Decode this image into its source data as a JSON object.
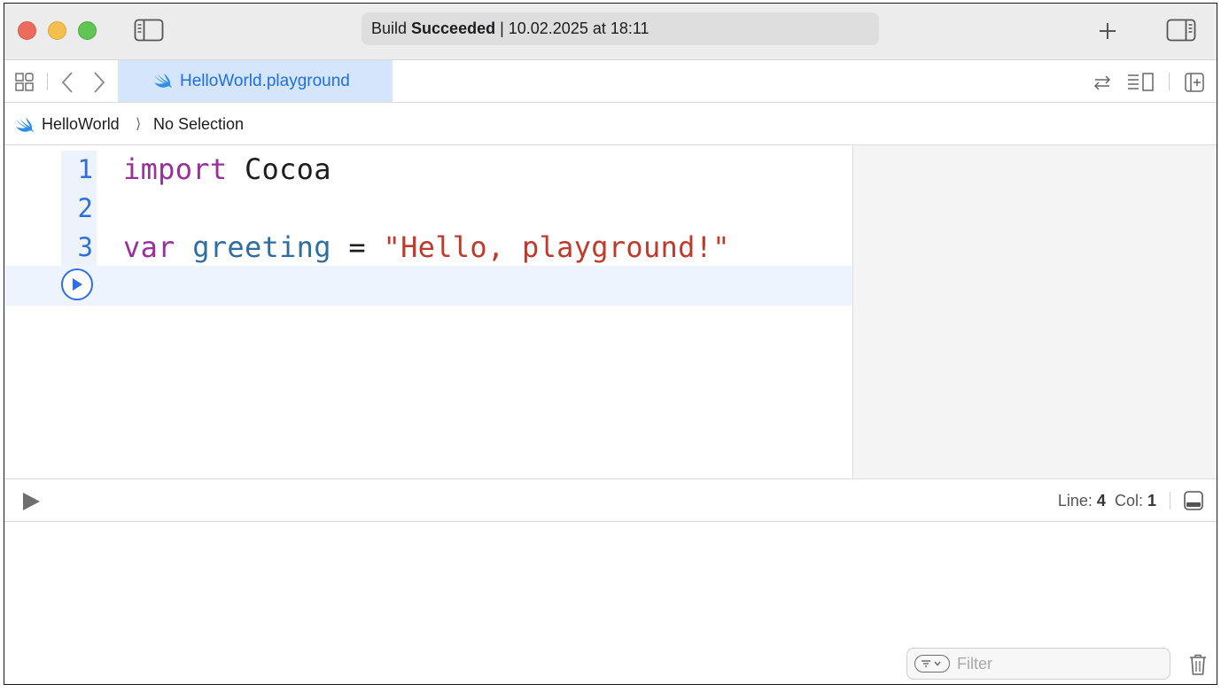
{
  "titlebar": {
    "status_prefix": "Build",
    "status_bold": "Succeeded",
    "status_suffix": "| 10.02.2025 at 18:11"
  },
  "tabbar": {
    "active_tab": "HelloWorld.playground"
  },
  "breadcrumb": {
    "project": "HelloWorld",
    "selection": "No Selection"
  },
  "editor": {
    "lines": [
      {
        "number": "1",
        "tokens": [
          {
            "text": "import",
            "kind": "kw"
          },
          {
            "text": " Cocoa",
            "kind": "plain"
          }
        ]
      },
      {
        "number": "2",
        "tokens": []
      },
      {
        "number": "3",
        "tokens": [
          {
            "text": "var",
            "kind": "kw"
          },
          {
            "text": " greeting",
            "kind": "ident"
          },
          {
            "text": " = ",
            "kind": "plain"
          },
          {
            "text": "\"Hello, playground!\"",
            "kind": "str"
          }
        ]
      }
    ]
  },
  "debugbar": {
    "line_label": "Line:",
    "line_value": "4",
    "col_label": "Col:",
    "col_value": "1"
  },
  "console": {
    "filter_placeholder": "Filter"
  },
  "colors": {
    "keyword": "#9b2f9b",
    "identifier": "#2f6ea0",
    "string": "#c0392b",
    "accent": "#2f6ee5"
  },
  "icons": {
    "sidebar_toggle": "sidebar-left-icon",
    "add": "plus-icon",
    "inspector_toggle": "sidebar-right-icon",
    "related_items": "grid-icon",
    "back": "chevron-left-icon",
    "forward": "chevron-right-icon",
    "swap": "arrows-swap-icon",
    "editor_options": "lines-editor-icon",
    "add_editor": "add-editor-icon",
    "run": "play-icon",
    "console_toggle": "bottom-panel-icon",
    "filter": "filter-icon",
    "trash": "trash-icon"
  }
}
